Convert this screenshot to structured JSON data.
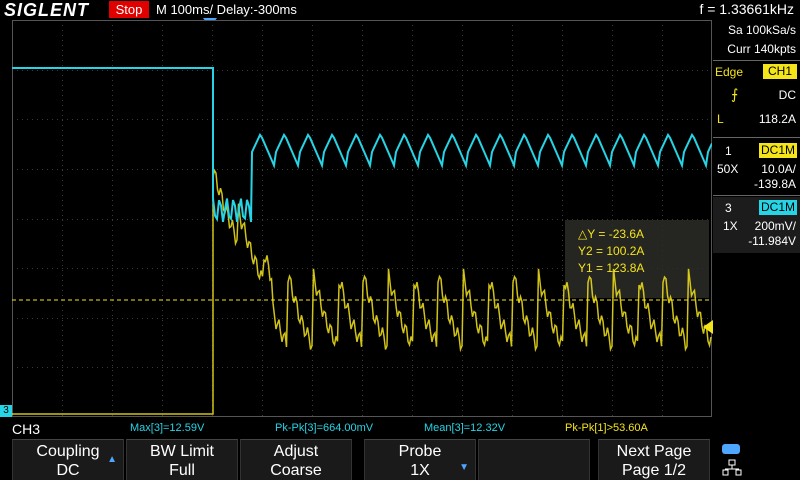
{
  "header": {
    "brand": "SIGLENT",
    "run_state": "Stop",
    "timebase": "M 100ms/  Delay:-300ms",
    "frequency": "f = 1.33661kHz"
  },
  "acquisition": {
    "sample_rate": "Sa 100kSa/s",
    "memory": "Curr 140kpts"
  },
  "trigger": {
    "type": "Edge",
    "source": "CH1",
    "coupling": "DC",
    "level_marker": "L",
    "level": "118.2A"
  },
  "channels": [
    {
      "id": "1",
      "coupling": "DC1M",
      "probe": "50X",
      "scale": "10.0A/",
      "offset": "-139.8A",
      "color": "#f4e41a"
    },
    {
      "id": "3",
      "coupling": "DC1M",
      "probe": "1X",
      "scale": "200mV/",
      "offset": "-11.984V",
      "color": "#26d4e6"
    }
  ],
  "cursors": {
    "delta_y": "△Y = -23.6A",
    "y2": "Y2 = 100.2A",
    "y1": "Y1 = 123.8A"
  },
  "measurements": [
    {
      "text": "Max[3]=12.59V",
      "color": "#26d4e6"
    },
    {
      "text": "Pk-Pk[3]=664.00mV",
      "color": "#26d4e6"
    },
    {
      "text": "Mean[3]=12.32V",
      "color": "#26d4e6"
    },
    {
      "text": "Pk-Pk[1]>53.60A",
      "color": "#f4e41a"
    }
  ],
  "menu": {
    "title": "CH3",
    "softkeys": [
      {
        "line1": "Coupling",
        "line2": "DC",
        "arrow": "▲"
      },
      {
        "line1": "BW Limit",
        "line2": "Full",
        "arrow": ""
      },
      {
        "line1": "Adjust",
        "line2": "Coarse",
        "arrow": ""
      },
      {
        "line1": "Probe",
        "line2": "1X",
        "arrow": "▼"
      },
      {
        "line1": "",
        "line2": "",
        "arrow": ""
      },
      {
        "line1": "Next Page",
        "line2": "Page 1/2",
        "arrow": ""
      }
    ]
  },
  "colors": {
    "ch1": "#f4e41a",
    "ch3": "#26d4e6",
    "accent": "#4fa6ff",
    "stop": "#e00000"
  }
}
